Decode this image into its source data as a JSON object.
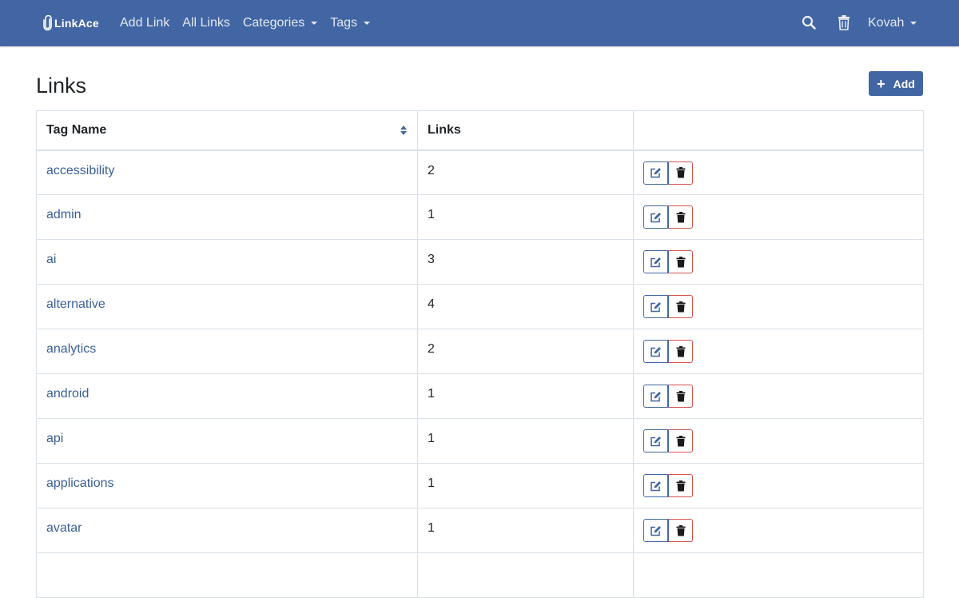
{
  "navbar": {
    "brand": "LinkAce",
    "links": [
      {
        "label": "Add Link",
        "dropdown": false
      },
      {
        "label": "All Links",
        "dropdown": false
      },
      {
        "label": "Categories",
        "dropdown": true
      },
      {
        "label": "Tags",
        "dropdown": true
      }
    ],
    "search_icon": "search-icon",
    "trash_icon": "trash-icon",
    "user": "Kovah"
  },
  "page": {
    "title": "Links",
    "add_button": "Add"
  },
  "table": {
    "columns": [
      "Tag Name",
      "Links",
      ""
    ],
    "rows": [
      {
        "name": "accessibility",
        "links": "2"
      },
      {
        "name": "admin",
        "links": "1"
      },
      {
        "name": "ai",
        "links": "3"
      },
      {
        "name": "alternative",
        "links": "4"
      },
      {
        "name": "analytics",
        "links": "2"
      },
      {
        "name": "android",
        "links": "1"
      },
      {
        "name": "api",
        "links": "1"
      },
      {
        "name": "applications",
        "links": "1"
      },
      {
        "name": "avatar",
        "links": "1"
      },
      {
        "name": "",
        "links": ""
      }
    ]
  },
  "colors": {
    "primary": "#4266a4",
    "link": "#3a5f99",
    "danger": "#d9534f",
    "border": "#d8e0e8"
  }
}
